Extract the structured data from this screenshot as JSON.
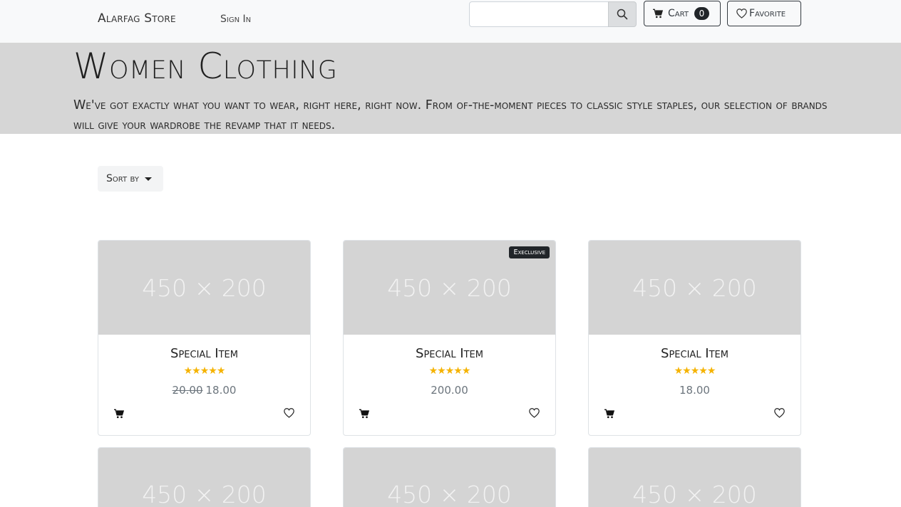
{
  "nav": {
    "brand": "Alarfag Store",
    "signin": "Sign In",
    "search_placeholder": "",
    "cart_label": "Cart",
    "cart_count": "0",
    "favorite_label": "Favorite"
  },
  "hero": {
    "title": "Women Clothing",
    "subtitle": "We've got exactly what you want to wear, right here, right now. From of-the-moment pieces to classic style staples, our selection of brands will give your wardrobe the revamp that it needs."
  },
  "sort": {
    "label": "Sort by"
  },
  "products": [
    {
      "image_text": "450 × 200",
      "title": "Special Item",
      "rating": "★★★★★",
      "old_price": "20.00",
      "price": "18.00",
      "tag": ""
    },
    {
      "image_text": "450 × 200",
      "title": "Special Item",
      "rating": "★★★★★",
      "old_price": "",
      "price": "200.00",
      "tag": "Execlusive"
    },
    {
      "image_text": "450 × 200",
      "title": "Special Item",
      "rating": "★★★★★",
      "old_price": "",
      "price": "18.00",
      "tag": ""
    },
    {
      "image_text": "450 × 200"
    },
    {
      "image_text": "450 × 200"
    },
    {
      "image_text": "450 × 200"
    }
  ]
}
